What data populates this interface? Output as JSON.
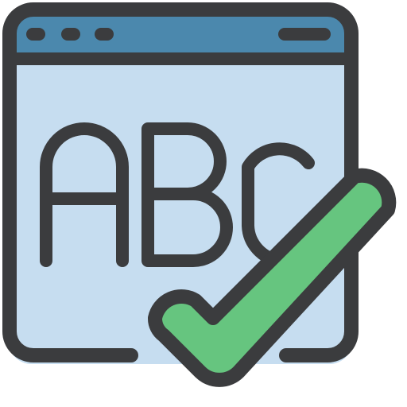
{
  "icon": {
    "name": "spell-check-window-icon",
    "letters": [
      "A",
      "B",
      "C"
    ],
    "window_dots": 3,
    "colors": {
      "outline": "#3b3c3e",
      "titlebar": "#4b88ad",
      "content": "#c6ddf0",
      "check": "#66c57f"
    }
  }
}
